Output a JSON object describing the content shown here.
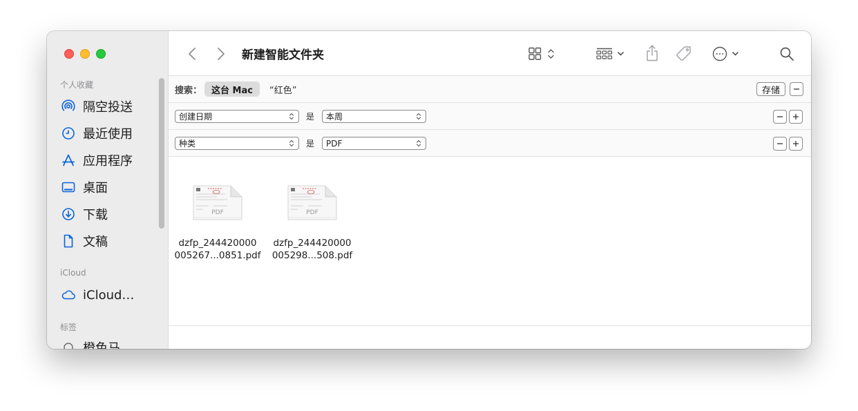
{
  "window": {
    "title": "新建智能文件夹"
  },
  "sidebar": {
    "favorites_header": "个人收藏",
    "favorites": [
      {
        "label": "隔空投送",
        "icon": "airdrop-icon"
      },
      {
        "label": "最近使用",
        "icon": "clock-icon"
      },
      {
        "label": "应用程序",
        "icon": "applications-icon"
      },
      {
        "label": "桌面",
        "icon": "desktop-icon"
      },
      {
        "label": "下载",
        "icon": "download-icon"
      },
      {
        "label": "文稿",
        "icon": "document-icon"
      }
    ],
    "icloud_header": "iCloud",
    "icloud": [
      {
        "label": "iCloud…",
        "icon": "cloud-icon"
      }
    ],
    "tags_header": "标签",
    "tags": [
      {
        "label": "橙色马",
        "icon": "tag-circle-icon"
      }
    ]
  },
  "search": {
    "label": "搜索：",
    "scope_active": "这台 Mac",
    "scope_query": "“红色”",
    "save_label": "存储"
  },
  "criteria": [
    {
      "attribute": "创建日期",
      "operator": "是",
      "value": "本周"
    },
    {
      "attribute": "种类",
      "operator": "是",
      "value": "PDF"
    }
  ],
  "files": [
    {
      "line1": "dzfp_244420000",
      "line2": "005267...0851.pdf",
      "badge": "PDF"
    },
    {
      "line1": "dzfp_244420000",
      "line2": "005298...508.pdf",
      "badge": "PDF"
    }
  ],
  "colors": {
    "close": "#fe5f57",
    "minimize": "#febc2e",
    "maximize": "#28c840",
    "sidebar_icon": "#0a64d8",
    "toolbar_icon": "#6e6e73"
  }
}
